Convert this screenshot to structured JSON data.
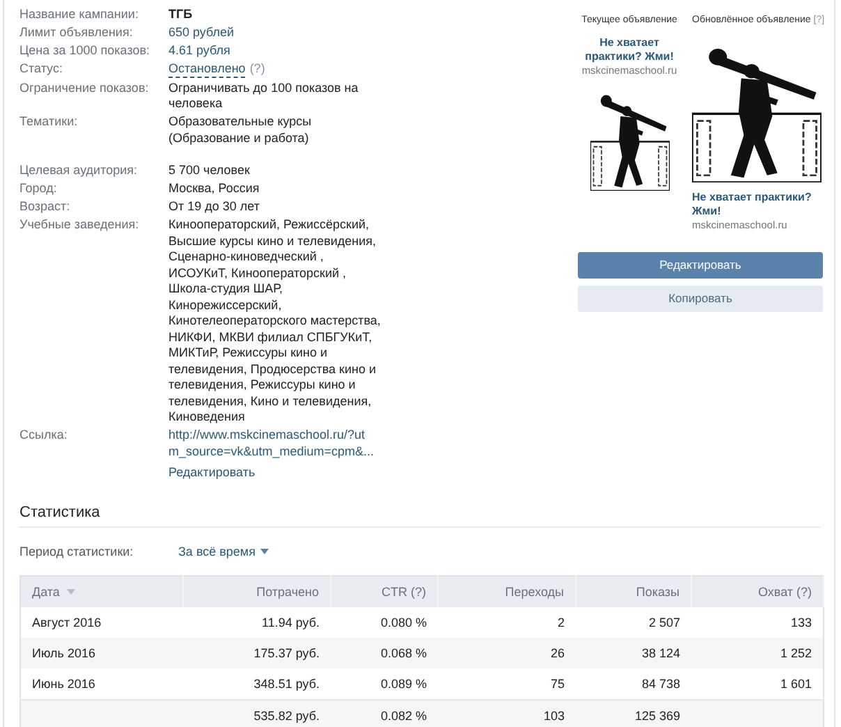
{
  "details": [
    {
      "label": "Название кампании:",
      "value": "ТГБ",
      "kind": "strong"
    },
    {
      "label": "Лимит объявления:",
      "value": "650 рублей",
      "kind": "link"
    },
    {
      "label": "Цена за 1000 показов:",
      "value": "4.61 рубля",
      "kind": "link"
    },
    {
      "label": "Статус:",
      "value": "Остановлено",
      "help": "(?)",
      "kind": "status"
    },
    {
      "label": "Ограничение показов:",
      "value": "Ограничивать до 100 показов на человека",
      "kind": "text"
    },
    {
      "label": "Тематики:",
      "value": "Образовательные курсы (Образование и работа)",
      "kind": "text"
    }
  ],
  "targeting": [
    {
      "label": "Целевая аудитория:",
      "value": "5 700 человек",
      "kind": "text"
    },
    {
      "label": "Город:",
      "value": "Москва, Россия",
      "kind": "text"
    },
    {
      "label": "Возраст:",
      "value": "От 19 до 30 лет",
      "kind": "text"
    },
    {
      "label": "Учебные заведения:",
      "value": "Кинооператорский, Режиссёрский, Высшие курсы кино и телевидения, Сценарно-киноведческий , ИСОУКиТ, Кинооператорский , Школа-студия ШАР, Кинорежиссерский, Кинотелеоператорского мастерства, НИКФИ, МКВИ филиал СПБГУКиТ, МИКТиР, Режиссуры кино и телевидения, Продюсерства кино и телевидения, Режиссуры кино и телевидения, Кино и телевидения, Киноведения",
      "kind": "text"
    },
    {
      "label": "Ссылка:",
      "value": "http://www.mskcinemaschool.ru/?utm_source=vk&utm_medium=cpm&...",
      "kind": "url",
      "edit": "Редактировать"
    }
  ],
  "previews": {
    "current": {
      "caption": "Текущее объявление",
      "title": "Не хватает практики? Жми!",
      "domain": "mskcinemaschool.ru"
    },
    "updated": {
      "caption": "Обновлённое объявление",
      "help": "[?]",
      "title": "Не хватает практики? Жми!",
      "domain": "mskcinemaschool.ru"
    }
  },
  "buttons": [
    {
      "label": "Редактировать",
      "kind": "primary"
    },
    {
      "label": "Копировать",
      "kind": "secondary"
    }
  ],
  "statistics": {
    "heading": "Статистика",
    "period_label": "Период статистики:",
    "period_value": "За всё время",
    "columns": [
      {
        "label": "Дата",
        "sorted": true
      },
      {
        "label": "Потрачено",
        "sorted": false
      },
      {
        "label": "CTR (?)",
        "sorted": false
      },
      {
        "label": "Переходы",
        "sorted": false
      },
      {
        "label": "Показы",
        "sorted": false
      },
      {
        "label": "Охват (?)",
        "sorted": false
      }
    ],
    "rows": [
      {
        "cells": [
          "Август 2016",
          "11.94 руб.",
          "0.080 %",
          "2",
          "2 507",
          "133"
        ]
      },
      {
        "cells": [
          "Июль 2016",
          "175.37 руб.",
          "0.068 %",
          "26",
          "38 124",
          "1 252"
        ]
      },
      {
        "cells": [
          "Июнь 2016",
          "348.51 руб.",
          "0.089 %",
          "75",
          "84 738",
          "1 601"
        ]
      }
    ],
    "total": [
      "535.82 руб.",
      "0.082 %",
      "103",
      "125 369"
    ]
  }
}
